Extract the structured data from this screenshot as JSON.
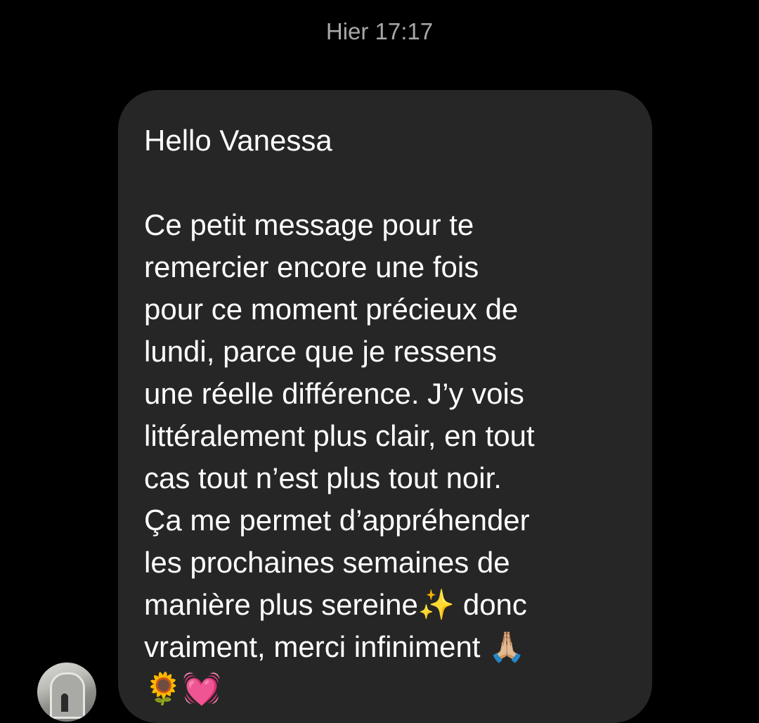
{
  "timestamp": "Hier 17:17",
  "message": {
    "greeting": "Hello Vanessa",
    "lines": [
      "Ce petit message pour te",
      "remercier encore une fois",
      "pour ce moment précieux de",
      "lundi, parce que je ressens",
      "une réelle différence. J’y vois",
      "littéralement plus clair, en tout",
      "cas tout n’est plus tout noir.",
      "Ça me permet d’appréhender",
      "les prochaines semaines de"
    ],
    "line10_text": "manière plus sereine",
    "line10_emoji": "✨",
    "line10_tail": " donc",
    "line11_text": "vraiment, merci infiniment ",
    "line11_emoji": "🙏🏼",
    "line12_emojis": "🌻💓"
  },
  "avatar": {
    "icon": "profile-photo"
  }
}
